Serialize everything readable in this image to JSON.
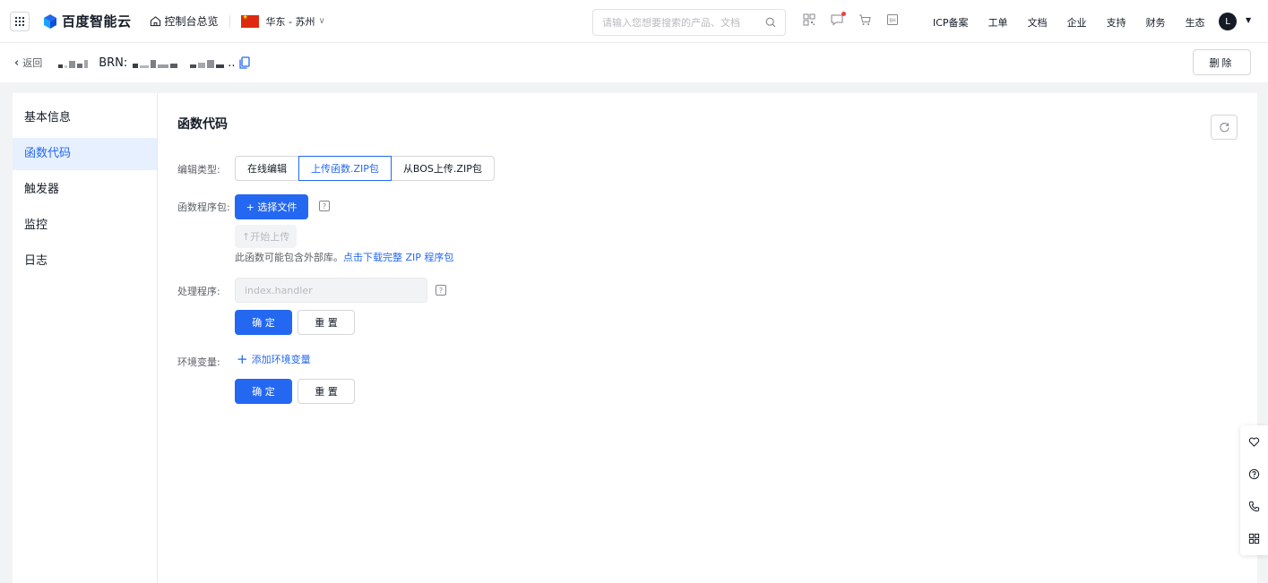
{
  "topbar": {
    "brand": "百度智能云",
    "console_home": "控制台总览",
    "region": "华东 - 苏州",
    "search_placeholder": "请输入您想要搜索的产品、文档",
    "links": [
      "ICP备案",
      "工单",
      "文档",
      "企业",
      "支持",
      "财务",
      "生态"
    ],
    "avatar_letter": "L"
  },
  "subheader": {
    "back_label": "返回",
    "brn_label": "BRN:",
    "brn_suffix": "..",
    "delete_label": "删除"
  },
  "sidenav": {
    "items": [
      {
        "label": "基本信息",
        "active": false
      },
      {
        "label": "函数代码",
        "active": true
      },
      {
        "label": "触发器",
        "active": false
      },
      {
        "label": "监控",
        "active": false
      },
      {
        "label": "日志",
        "active": false
      }
    ]
  },
  "main": {
    "title": "函数代码",
    "edit_type_label": "编辑类型:",
    "edit_types": [
      {
        "label": "在线编辑",
        "active": false
      },
      {
        "label": "上传函数.ZIP包",
        "active": true
      },
      {
        "label": "从BOS上传.ZIP包",
        "active": false
      }
    ],
    "package_label": "函数程序包:",
    "select_file": "+ 选择文件",
    "start_upload": "↑开始上传",
    "hint_text": "此函数可能包含外部库。",
    "hint_link": "点击下载完整 ZIP 程序包",
    "handler_label": "处理程序:",
    "handler_placeholder": "index.handler",
    "confirm": "确 定",
    "reset": "重 置",
    "env_label": "环境变量:",
    "add_env": "添加环境变量"
  },
  "colors": {
    "primary": "#2468f2",
    "active_bg": "#e6f0ff",
    "text": "#151b26"
  }
}
